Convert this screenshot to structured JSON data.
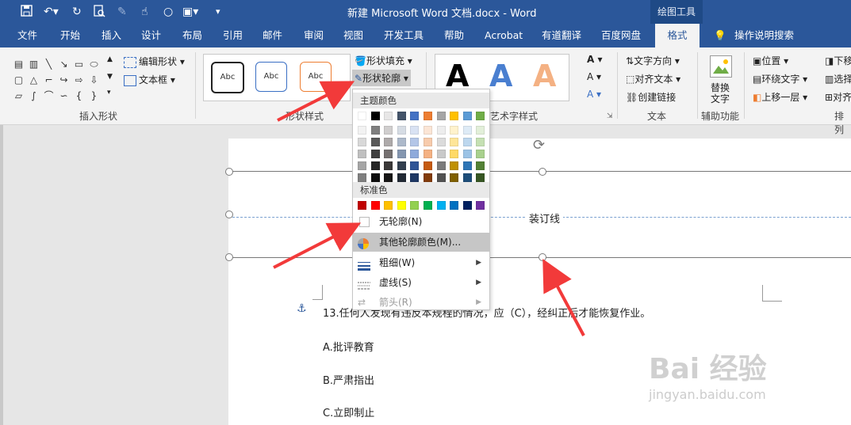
{
  "titlebar": {
    "title": "新建 Microsoft Word 文档.docx  -  Word",
    "drawing_tools": "绘图工具"
  },
  "tabs": [
    "文件",
    "开始",
    "插入",
    "设计",
    "布局",
    "引用",
    "邮件",
    "审阅",
    "视图",
    "开发工具",
    "帮助",
    "Acrobat",
    "有道翻译",
    "百度网盘",
    "格式"
  ],
  "tell_me": "操作说明搜索",
  "ribbon": {
    "insert_shapes": {
      "label": "插入形状",
      "edit_shape": "编辑形状",
      "text_box": "文本框"
    },
    "shape_styles": {
      "label": "形状样式",
      "style_previews": [
        "Abc",
        "Abc",
        "Abc"
      ],
      "shape_fill": "形状填充",
      "shape_outline": "形状轮廓"
    },
    "wordart": {
      "label": "艺术字样式",
      "letters": [
        "A",
        "A",
        "A"
      ]
    },
    "text": {
      "label": "文本",
      "text_direction": "文字方向",
      "align_text": "对齐文本",
      "create_link": "创建链接"
    },
    "accessibility": {
      "label": "辅助功能",
      "alt_text_line1": "替换",
      "alt_text_line2": "文字"
    },
    "arrange": {
      "label": "排列",
      "position": "位置",
      "wrap_text": "环绕文字",
      "bring_forward": "上移一层",
      "send_backward": "下移",
      "selection_pane": "选择",
      "align": "对齐"
    }
  },
  "dropdown": {
    "theme_colors_header": "主题颜色",
    "standard_colors_header": "标准色",
    "no_outline": "无轮廓(N)",
    "more_colors": "其他轮廓颜色(M)...",
    "weight": "粗细(W)",
    "dashes": "虚线(S)",
    "arrows": "箭头(R)",
    "theme_top": [
      "#ffffff",
      "#000000",
      "#e7e6e6",
      "#44546a",
      "#4472c4",
      "#ed7d31",
      "#a5a5a5",
      "#ffc000",
      "#5b9bd5",
      "#70ad47"
    ],
    "theme_shades": [
      [
        "#f2f2f2",
        "#7f7f7f",
        "#d0cece",
        "#d6dce4",
        "#d9e2f3",
        "#fbe5d5",
        "#ededed",
        "#fff2cc",
        "#deebf6",
        "#e2efd9"
      ],
      [
        "#d8d8d8",
        "#595959",
        "#aeaaaa",
        "#adb9ca",
        "#b4c6e7",
        "#f7cbac",
        "#dbdbdb",
        "#fee599",
        "#bdd7ee",
        "#c5e0b3"
      ],
      [
        "#bfbfbf",
        "#3f3f3f",
        "#757070",
        "#8496b0",
        "#8eaadb",
        "#f4b183",
        "#c9c9c9",
        "#ffd965",
        "#9cc3e5",
        "#a8d08d"
      ],
      [
        "#a5a5a5",
        "#262626",
        "#3a3838",
        "#323f4f",
        "#2f5496",
        "#c55a11",
        "#7b7b7b",
        "#bf9000",
        "#2e75b5",
        "#538135"
      ],
      [
        "#7f7f7f",
        "#0c0c0c",
        "#171616",
        "#222a35",
        "#1f3864",
        "#833c0b",
        "#525252",
        "#7f6000",
        "#1e4e79",
        "#375623"
      ]
    ],
    "standard": [
      "#c00000",
      "#ff0000",
      "#ffc000",
      "#ffff00",
      "#92d050",
      "#00b050",
      "#00b0f0",
      "#0070c0",
      "#002060",
      "#7030a0"
    ]
  },
  "document": {
    "binding_line": "装订线",
    "question": "13.任何人发现有违反本规程的情况，应（C），经纠正后才能恢复作业。",
    "options": [
      "A.批评教育",
      "B.严肃指出",
      "C.立即制止"
    ]
  },
  "watermark": {
    "line1": "Bai 经验",
    "line2": "jingyan.baidu.com"
  }
}
